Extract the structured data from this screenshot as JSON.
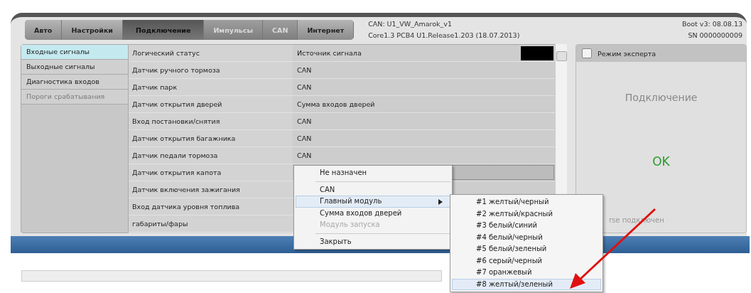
{
  "tabs": [
    {
      "label": "Авто",
      "selected": false,
      "disabled": false
    },
    {
      "label": "Настройки",
      "selected": false,
      "disabled": false
    },
    {
      "label": "Подключение",
      "selected": true,
      "disabled": false
    },
    {
      "label": "Импульсы",
      "selected": false,
      "disabled": true
    },
    {
      "label": "CAN",
      "selected": false,
      "disabled": true
    },
    {
      "label": "Интернет",
      "selected": false,
      "disabled": false
    }
  ],
  "device_info": {
    "can": "CAN: U1_VW_Amarok_v1",
    "core": "Core1.3 PCB4 U1.Release1.203 (18.07.2013)",
    "boot": "Boot v3: 08.08.13",
    "serial": "SN 0000000009"
  },
  "sidebar": {
    "items": [
      {
        "label": "Входные сигналы",
        "selected": true,
        "disabled": false
      },
      {
        "label": "Выходные сигналы",
        "selected": false,
        "disabled": false
      },
      {
        "label": "Диагностика входов",
        "selected": false,
        "disabled": false
      },
      {
        "label": "Пороги срабатывания",
        "selected": false,
        "disabled": true
      }
    ]
  },
  "table": {
    "columns": [
      "Логический статус",
      "Источник сигнала"
    ],
    "rows": [
      {
        "name": "Датчик ручного тормоза",
        "source": "CAN",
        "selected": false
      },
      {
        "name": "Датчик парк",
        "source": "CAN",
        "selected": false
      },
      {
        "name": "Датчик открытия дверей",
        "source": "Сумма входов дверей",
        "selected": false
      },
      {
        "name": "Вход постановки/снятия",
        "source": "CAN",
        "selected": false
      },
      {
        "name": "Датчик открытия багажника",
        "source": "CAN",
        "selected": false
      },
      {
        "name": "Датчик педали тормоза",
        "source": "CAN",
        "selected": false
      },
      {
        "name": "Датчик открытия капота",
        "selected": true
      },
      {
        "name": "Датчик включения зажигания",
        "selected": false
      },
      {
        "name": "Вход датчика уровня топлива",
        "selected": false
      },
      {
        "name": "габариты/фары",
        "selected": false
      }
    ]
  },
  "expert_mode": {
    "label": "Режим эксперта",
    "checked": false
  },
  "status_panel": {
    "title": "Подключение",
    "status": "OK",
    "note": "rse подключен"
  },
  "context_menu": {
    "items": [
      {
        "kind": "item",
        "label": "Не назначен",
        "disabled": false,
        "selected": false
      },
      {
        "kind": "separator"
      },
      {
        "kind": "item",
        "label": "CAN",
        "disabled": false,
        "selected": false
      },
      {
        "kind": "submenu",
        "label": "Главный модуль",
        "disabled": false,
        "selected": true
      },
      {
        "kind": "item",
        "label": "Сумма входов дверей",
        "disabled": false,
        "selected": false
      },
      {
        "kind": "item",
        "label": "Модуль запуска",
        "disabled": true,
        "selected": false
      },
      {
        "kind": "separator"
      },
      {
        "kind": "item",
        "label": "Закрыть",
        "disabled": false,
        "selected": false
      }
    ]
  },
  "submenu": {
    "items": [
      {
        "label": "#1 желтый/черный",
        "selected": false
      },
      {
        "label": "#2 желтый/красный",
        "selected": false
      },
      {
        "label": "#3 белый/синий",
        "selected": false
      },
      {
        "label": "#4 белый/черный",
        "selected": false
      },
      {
        "label": "#5 белый/зеленый",
        "selected": false
      },
      {
        "label": "#6 серый/черный",
        "selected": false
      },
      {
        "label": "#7 оранжевый",
        "selected": false
      },
      {
        "label": "#8 желтый/зеленый",
        "selected": true
      }
    ]
  }
}
